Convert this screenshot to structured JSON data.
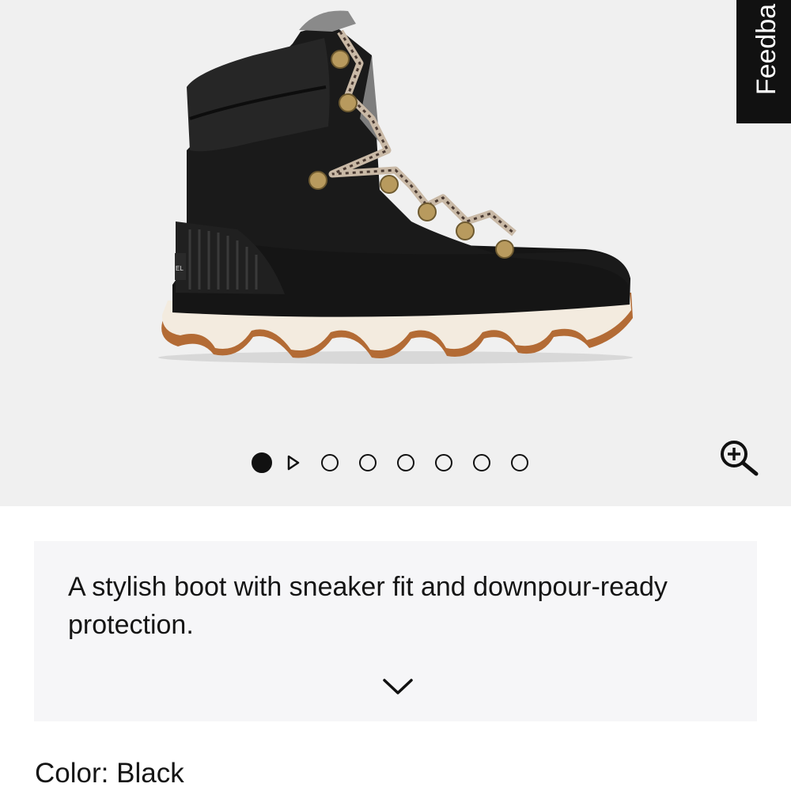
{
  "feedback": {
    "label": "Feedba"
  },
  "gallery": {
    "slide_count": 7,
    "current_slide": 1,
    "has_video": true
  },
  "description": {
    "text": "A stylish boot with sneaker fit and downpour-ready protection."
  },
  "color": {
    "label": "Color:",
    "value": "Black"
  },
  "icons": {
    "zoom": "zoom-in-icon",
    "play": "play-icon",
    "expand": "chevron-down-icon"
  },
  "colors": {
    "gallery_bg": "#f0f0f0",
    "panel_bg": "#f6f6f8",
    "text": "#151515",
    "feedback_bg": "#111111"
  }
}
